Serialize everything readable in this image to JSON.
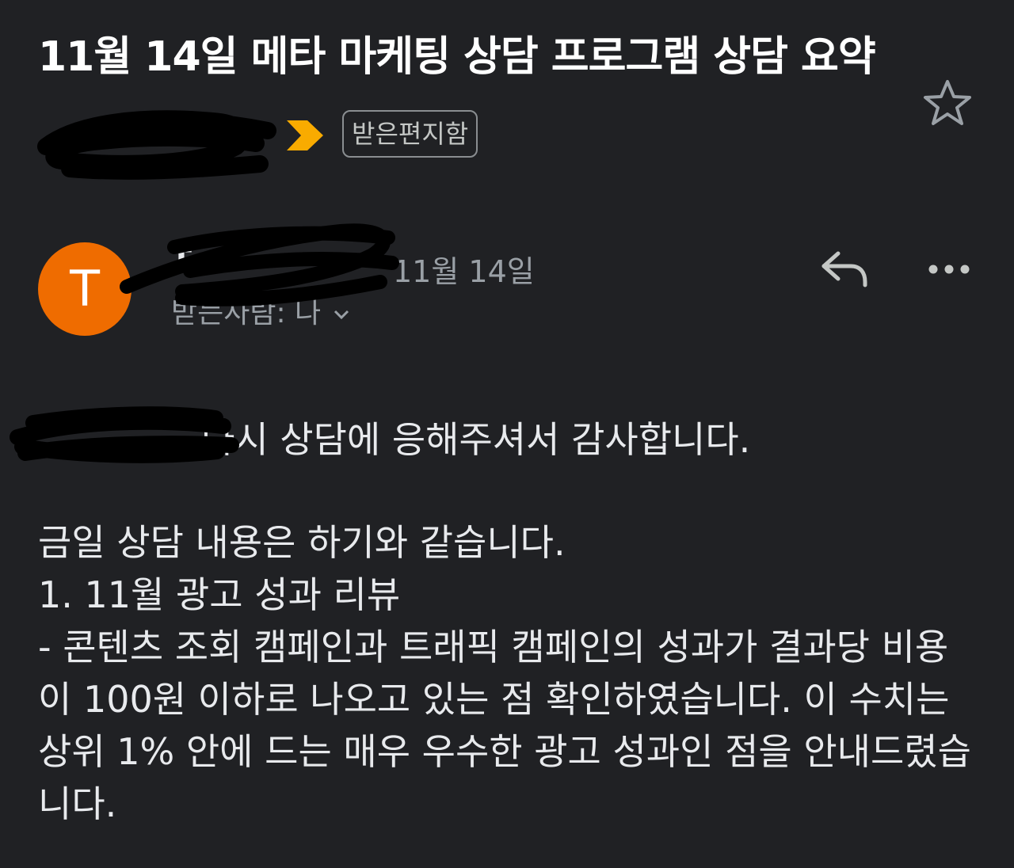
{
  "email": {
    "subject": "11월 14일 메타 마케팅 상담 프로그램 상담 요약",
    "label": "받은편지함",
    "sender": {
      "avatar_letter": "T",
      "name": "T m",
      "date": "11월 14일",
      "recipient": "받는사람: 나"
    },
    "body": {
      "greeting": "다시 상담에 응해주셔서 감사합니다.",
      "intro": "금일 상담 내용은 하기와 같습니다.",
      "item_heading": "1. 11월 광고 성과 리뷰",
      "item_text": "- 콘텐츠 조회 캠페인과 트래픽 캠페인의 성과가 결과당 비용이 100원 이하로 나오고 있는 점 확인하였습니다. 이 수치는 상위 1% 안에 드는 매우 우수한 광고 성과인 점을 안내드렸습니다."
    }
  },
  "icons": {
    "importance": "importance-marker-icon",
    "star": "star-outline-icon",
    "reply": "reply-icon",
    "more": "more-horizontal-icon",
    "chevron": "chevron-down-icon"
  },
  "colors": {
    "background": "#202124",
    "avatar": "#ef6c00",
    "importance": "#f9ab00"
  }
}
